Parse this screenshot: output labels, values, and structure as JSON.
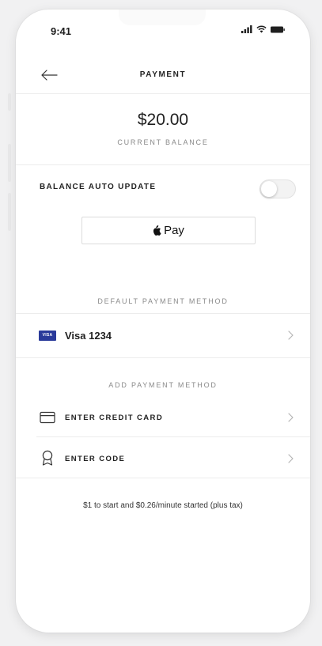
{
  "status_bar": {
    "time": "9:41"
  },
  "nav": {
    "title": "PAYMENT"
  },
  "balance": {
    "amount": "$20.00",
    "label": "CURRENT BALANCE"
  },
  "auto_update": {
    "label": "BALANCE AUTO UPDATE",
    "enabled": false
  },
  "apple_pay": {
    "label": "Pay"
  },
  "default_method": {
    "section_label": "DEFAULT PAYMENT METHOD",
    "card_badge": "VISA",
    "card_label": "Visa 1234"
  },
  "add_method": {
    "section_label": "ADD PAYMENT METHOD",
    "items": [
      {
        "label": "ENTER CREDIT CARD",
        "icon": "credit-card-icon"
      },
      {
        "label": "ENTER CODE",
        "icon": "ribbon-badge-icon"
      }
    ]
  },
  "footer": {
    "note": "$1 to start and $0.26/minute started (plus tax)"
  },
  "colors": {
    "visa_blue": "#2a3a9a",
    "text_primary": "#1f1f1f",
    "text_secondary": "#8a8a8a",
    "divider": "#ececec"
  }
}
